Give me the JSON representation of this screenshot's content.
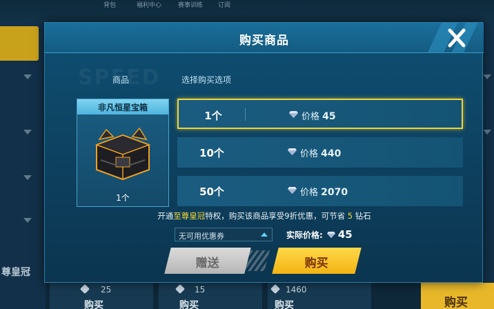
{
  "background": {
    "tabs": [
      "背包",
      "福利中心",
      "赛事训练",
      "订阅"
    ],
    "side_label": "尊皇冠",
    "cards": [
      {
        "amount": "25",
        "buy": "购买"
      },
      {
        "amount": "15",
        "buy": "购买"
      },
      {
        "amount": "1460",
        "buy": "购买"
      }
    ],
    "gold_button": "购买"
  },
  "dialog": {
    "title": "购买商品",
    "watermark": "SPEED",
    "column_headers": {
      "item": "商品",
      "options": "选择购买选项"
    },
    "item": {
      "name": "非凡恒星宝箱",
      "quantity": "1个"
    },
    "price_label": "价格",
    "options": [
      {
        "quantity": "1个",
        "price": "45",
        "selected": true
      },
      {
        "quantity": "10个",
        "price": "440",
        "selected": false
      },
      {
        "quantity": "50个",
        "price": "2070",
        "selected": false
      }
    ],
    "vip_line": {
      "prefix": "开通",
      "highlight": "至尊皇冠",
      "middle": "特权，购买该商品享受9折优惠，可节省",
      "saving": "5",
      "suffix": "钻石"
    },
    "coupon": {
      "selected": "无可用优惠券"
    },
    "actual_price": {
      "label": "实际价格:",
      "value": "45"
    },
    "buttons": {
      "gift": "赠送",
      "buy": "购买"
    }
  },
  "colors": {
    "selected_border": "#f0d438",
    "highlight_text": "#f3da3a",
    "buy_button": "#f3b412",
    "gift_button": "#c8c8c8"
  }
}
